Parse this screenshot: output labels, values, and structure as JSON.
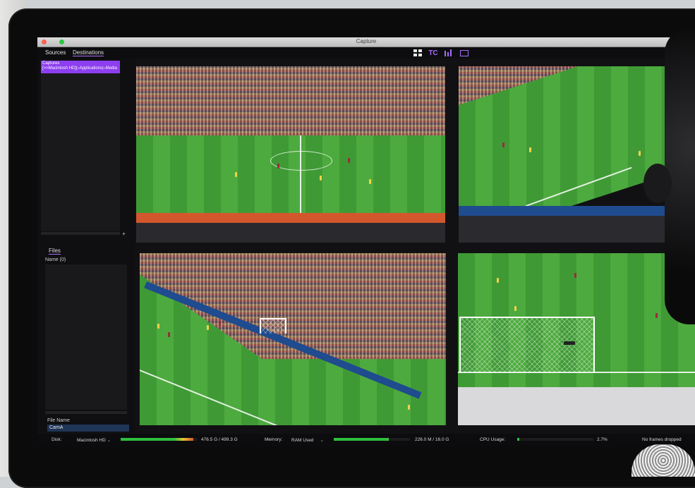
{
  "window": {
    "title": "Capture"
  },
  "toolbar": {
    "tabs": [
      "Sources",
      "Destinations"
    ],
    "active_tab": "Destinations",
    "view_buttons": [
      {
        "icon": "grid-view-icon",
        "label": ""
      },
      {
        "icon": "timecode-icon",
        "label": "TC"
      },
      {
        "icon": "audio-levels-icon",
        "label": ""
      },
      {
        "icon": "single-screen-icon",
        "label": ""
      }
    ],
    "accent_color": "#a86cff"
  },
  "sidebar": {
    "destinations": [
      {
        "name": "Captures",
        "path": "[>>Macintosh HD]▷Applications▷Media"
      }
    ],
    "add_label": "+",
    "files": {
      "tab_label": "Files",
      "column_header": "Name (0)"
    },
    "file_name": {
      "label": "File Name",
      "value": "CamA"
    }
  },
  "status": {
    "disk_label": "Disk:",
    "disk_select": "Macintosh HD",
    "disk_value": "476.5 G / 499.3 G",
    "disk_fraction": 0.954,
    "memory_label": "Memory:",
    "memory_select": "RAM Used",
    "memory_value": "226.0 M / 16.0 G",
    "memory_fraction": 0.72,
    "cpu_label": "CPU Usage:",
    "cpu_value": "2.7%",
    "cpu_fraction": 0.027,
    "frames_status": "No frames dropped",
    "colors": {
      "ok": "#2fbf3f",
      "warn": "#e6c534",
      "danger": "#d2312f"
    }
  },
  "feeds": [
    {
      "name": "camera-feed-1"
    },
    {
      "name": "camera-feed-2"
    },
    {
      "name": "camera-feed-3"
    },
    {
      "name": "camera-feed-4"
    }
  ]
}
